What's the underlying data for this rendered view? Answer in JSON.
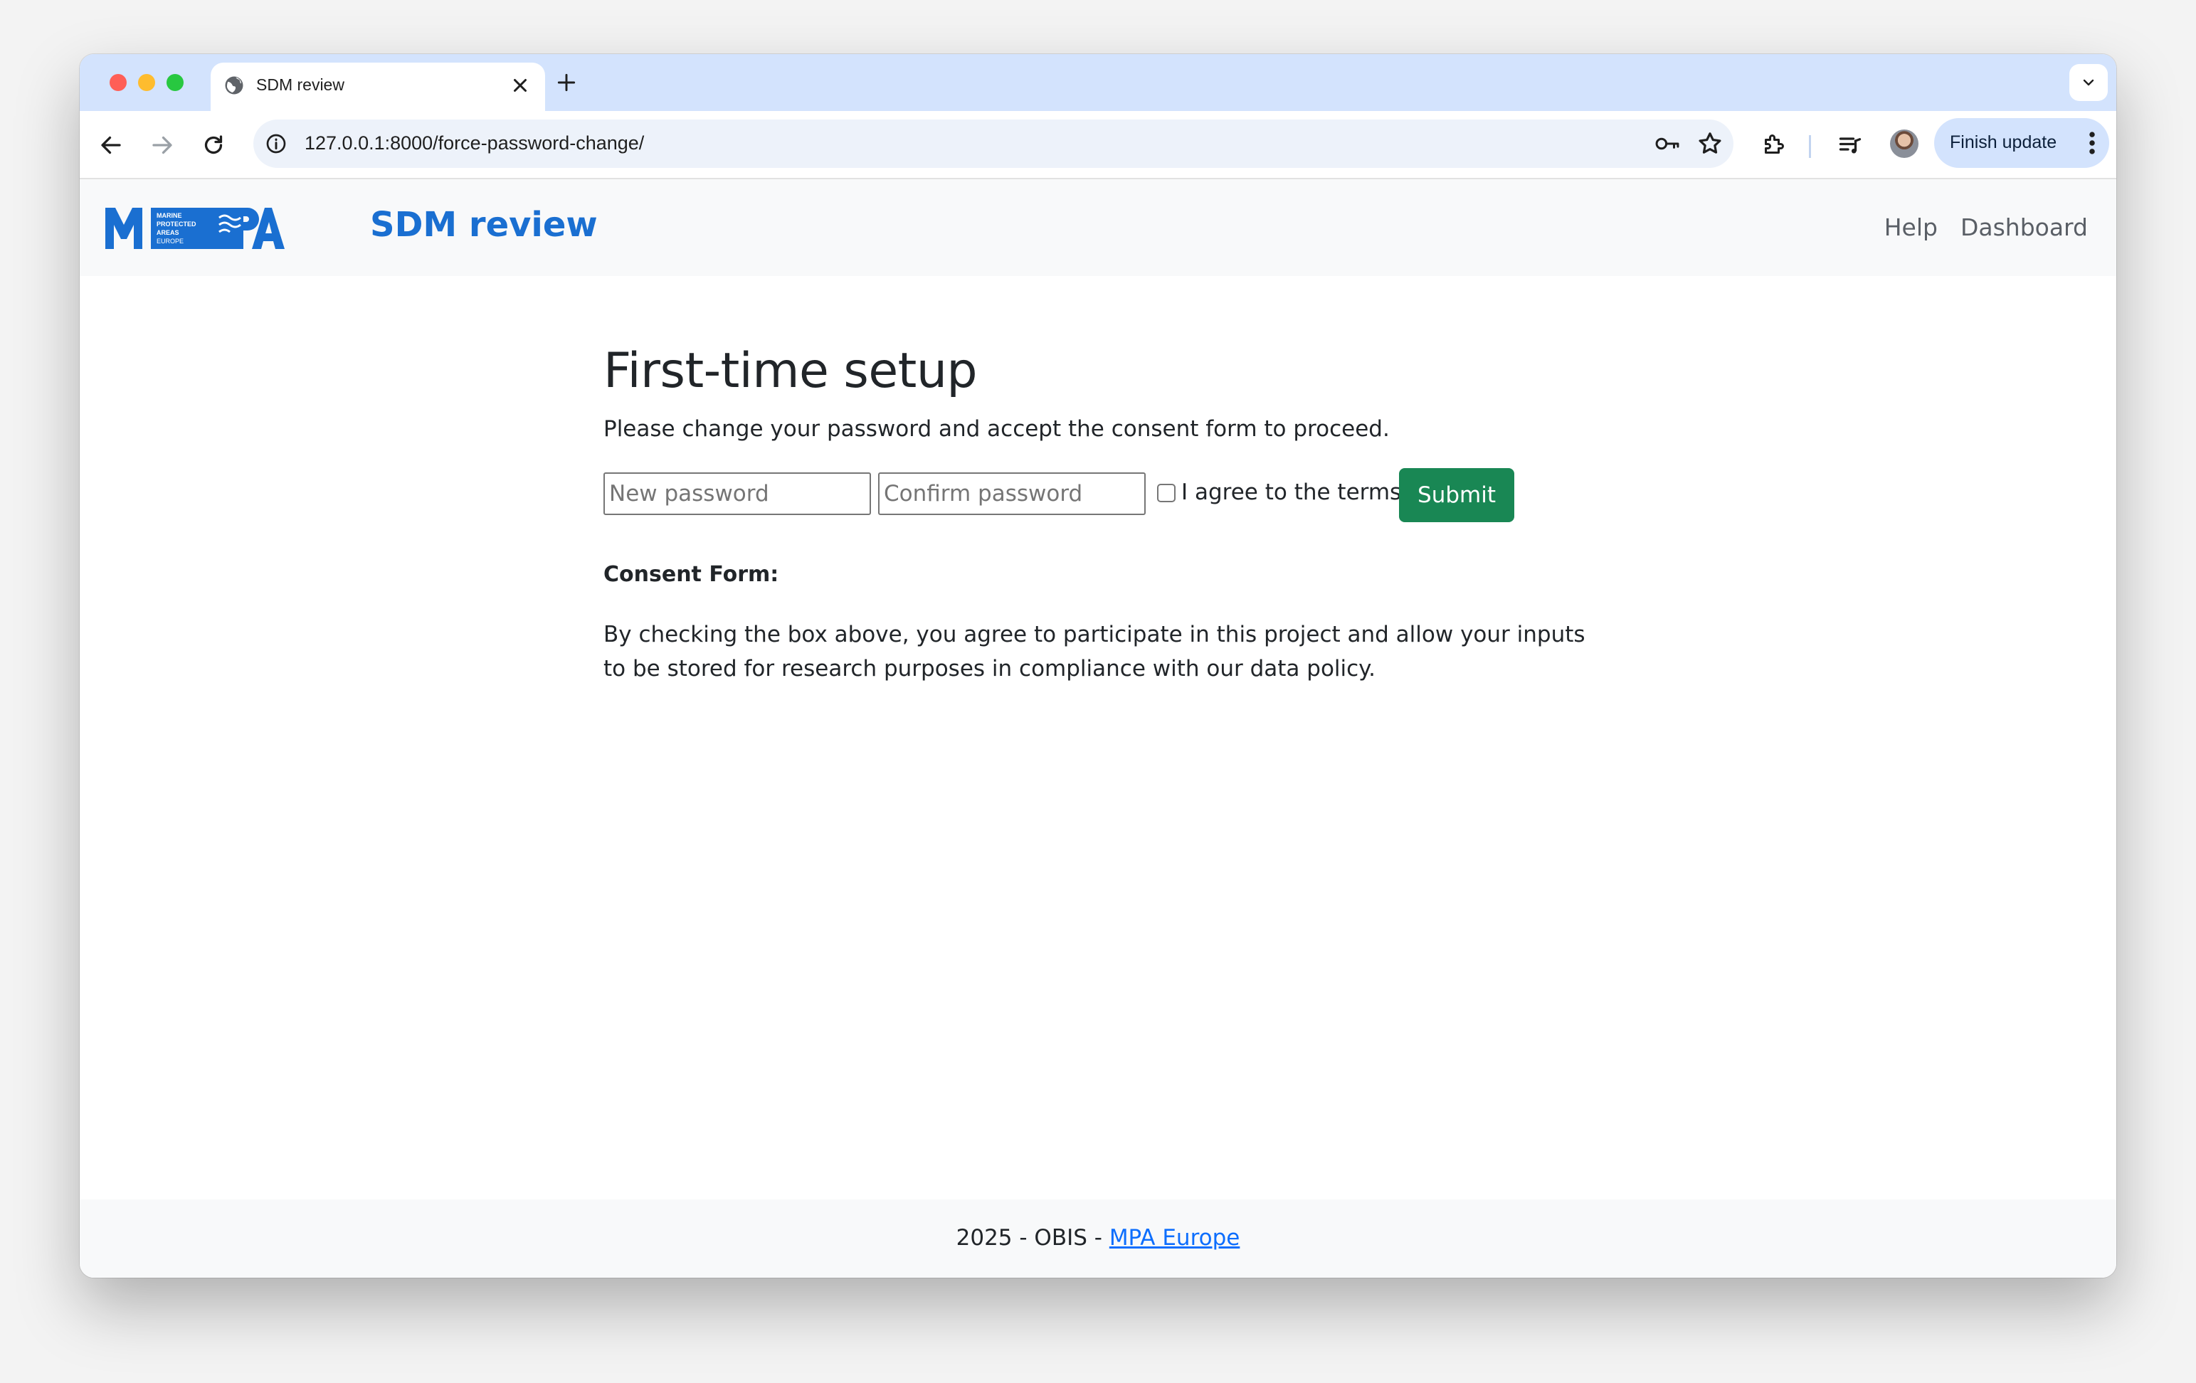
{
  "browser": {
    "tab_title": "SDM review",
    "url": "127.0.0.1:8000/force-password-change/",
    "finish_update_label": "Finish update"
  },
  "navbar": {
    "logo_text": "MPA",
    "logo_subtext": "MARINE PROTECTED AREAS EUROPE",
    "brand": "SDM review",
    "links": [
      "Help",
      "Dashboard"
    ]
  },
  "main": {
    "title": "First-time setup",
    "lead": "Please change your password and accept the consent form to proceed.",
    "form": {
      "new_password_placeholder": "New password",
      "confirm_password_placeholder": "Confirm password",
      "agree_label": "I agree to the terms",
      "agree_checked": false,
      "submit_label": "Submit"
    },
    "consent_heading": "Consent Form:",
    "consent_text": "By checking the box above, you agree to participate in this project and allow your inputs to be stored for research purposes in compliance with our data policy."
  },
  "footer": {
    "prefix": "2025 - OBIS - ",
    "link_text": "MPA Europe"
  },
  "colors": {
    "brand": "#1a6fd1",
    "submit": "#198754",
    "link": "#0d6efd",
    "tabstrip": "#d3e3fd"
  }
}
